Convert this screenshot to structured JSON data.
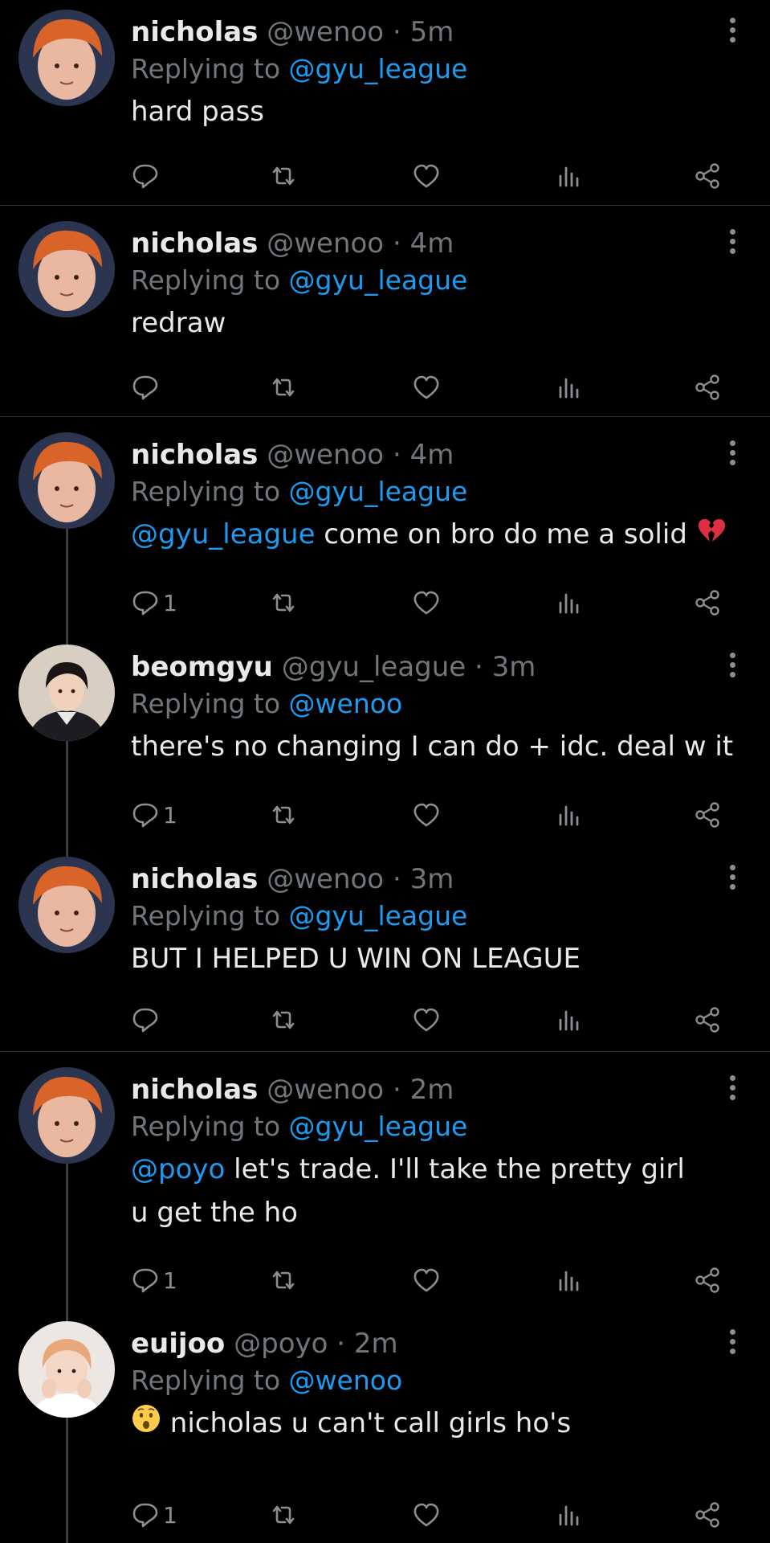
{
  "colors": {
    "background": "#000000",
    "text": "#e7e9ea",
    "muted": "#71767b",
    "mention": "#1d9bf0",
    "divider": "#2f3336"
  },
  "icons": {
    "reply": "reply-icon",
    "retweet": "retweet-icon",
    "like": "heart-icon",
    "views": "analytics-icon",
    "share": "share-icon",
    "more": "more-vertical-icon"
  },
  "tweets": [
    {
      "name": "nicholas",
      "handle": "@wenoo",
      "sep": "·",
      "time": "5m",
      "reply_prefix": "Replying to",
      "reply_to": "@gyu_league",
      "text": "hard pass",
      "reply_count": ""
    },
    {
      "name": "nicholas",
      "handle": "@wenoo",
      "sep": "·",
      "time": "4m",
      "reply_prefix": "Replying to",
      "reply_to": "@gyu_league",
      "text": "redraw",
      "reply_count": ""
    },
    {
      "name": "nicholas",
      "handle": "@wenoo",
      "sep": "·",
      "time": "4m",
      "reply_prefix": "Replying to",
      "reply_to": "@gyu_league",
      "text_mention": "@gyu_league",
      "text": " come on bro do me a solid ",
      "emoji": "broken-heart",
      "reply_count": "1"
    },
    {
      "name": "beomgyu",
      "handle": "@gyu_league",
      "sep": "·",
      "time": "3m",
      "reply_prefix": "Replying to",
      "reply_to": "@wenoo",
      "text": "there's no changing I can do + idc. deal w it",
      "reply_count": "1"
    },
    {
      "name": "nicholas",
      "handle": "@wenoo",
      "sep": "·",
      "time": "3m",
      "reply_prefix": "Replying to",
      "reply_to": "@gyu_league",
      "text": "BUT I HELPED U WIN ON LEAGUE",
      "reply_count": ""
    },
    {
      "name": "nicholas",
      "handle": "@wenoo",
      "sep": "·",
      "time": "2m",
      "reply_prefix": "Replying to",
      "reply_to": "@gyu_league",
      "text_mention": "@poyo",
      "text": " let's trade. I'll take the pretty girl u get the ho",
      "reply_count": "1"
    },
    {
      "name": "euijoo",
      "handle": "@poyo",
      "sep": "·",
      "time": "2m",
      "reply_prefix": "Replying to",
      "reply_to": "@wenoo",
      "emoji": "hushed-face",
      "text": " nicholas u can't call girls ho's",
      "reply_count": "1"
    }
  ]
}
